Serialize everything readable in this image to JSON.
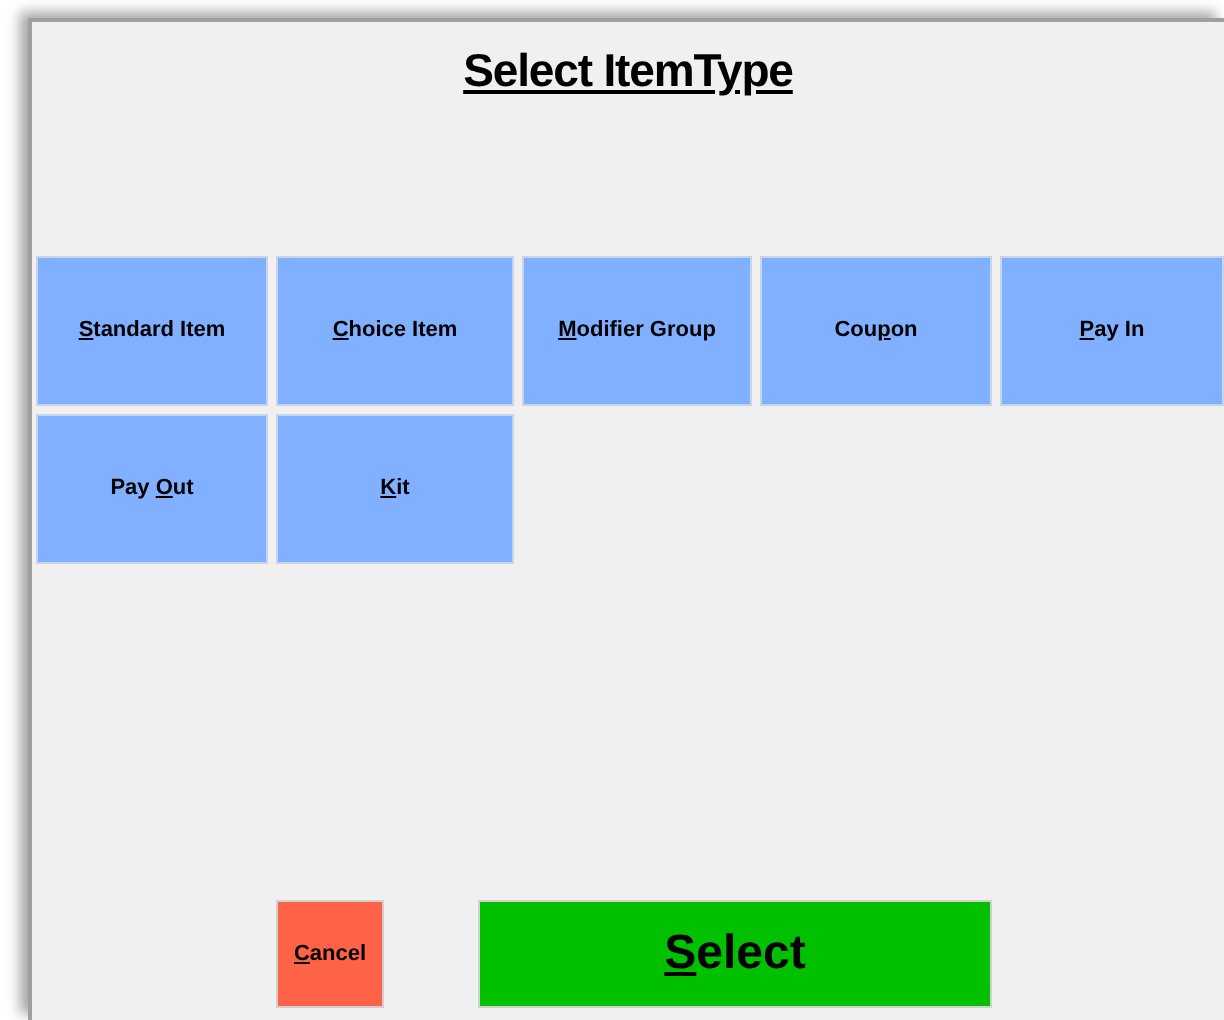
{
  "title": "Select ItemType",
  "item_types": [
    {
      "key": "S",
      "post": "tandard Item"
    },
    {
      "key": "C",
      "post": "hoice Item"
    },
    {
      "key": "M",
      "post": "odifier Group"
    },
    {
      "pre": "Cou",
      "key": "p",
      "post": "on"
    },
    {
      "key": "P",
      "post": "ay In"
    },
    {
      "pre": "Pay ",
      "key": "O",
      "post": "ut"
    },
    {
      "key": "K",
      "post": "it"
    }
  ],
  "actions": [
    {
      "kind": "cancel",
      "key": "C",
      "post": "ancel"
    },
    {
      "kind": "select",
      "key": "S",
      "post": "elect"
    }
  ]
}
